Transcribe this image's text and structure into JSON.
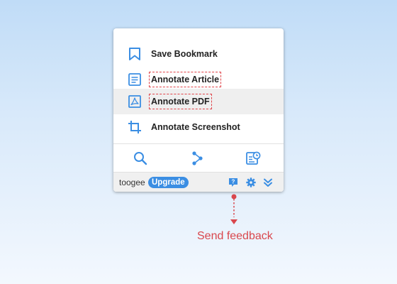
{
  "menu": {
    "items": [
      {
        "label": "Save Bookmark",
        "icon": "bookmark-icon"
      },
      {
        "label": "Annotate Article",
        "icon": "article-icon"
      },
      {
        "label": "Annotate PDF",
        "icon": "pdf-icon"
      },
      {
        "label": "Annotate Screenshot",
        "icon": "crop-icon"
      }
    ]
  },
  "tools": [
    {
      "icon": "search-icon"
    },
    {
      "icon": "share-icon"
    },
    {
      "icon": "recent-history-icon"
    }
  ],
  "footer": {
    "username": "toogee",
    "upgrade_label": "Upgrade",
    "help_icon": "help-icon",
    "settings_icon": "gear-icon",
    "expand_icon": "double-chevron-down-icon"
  },
  "annotation": {
    "feedback_label": "Send feedback"
  },
  "colors": {
    "accent": "#3b8ee3",
    "highlight": "#e0444a",
    "annotation": "#d9474d"
  }
}
